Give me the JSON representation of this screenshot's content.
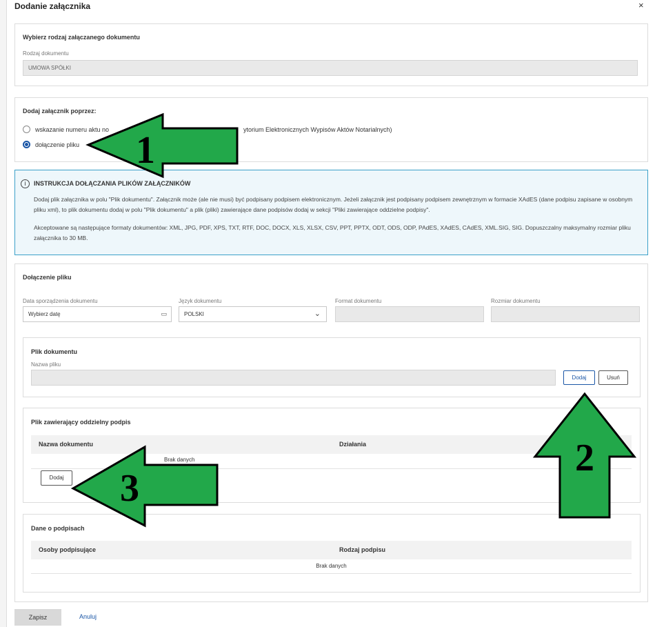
{
  "modal": {
    "title": "Dodanie załącznika"
  },
  "doc_type": {
    "title": "Wybierz rodzaj załączanego dokumentu",
    "label": "Rodzaj dokumentu",
    "value": "UMOWA SPÓŁKI"
  },
  "attach_via": {
    "title": "Dodaj załącznik poprzez:",
    "option1_start": "wskazanie numeru aktu no",
    "option1_end": "ytorium Elektronicznych Wypisów Aktów Notarialnych)",
    "option2": "dołączenie pliku"
  },
  "instructions": {
    "title": "INSTRUKCJA DOŁĄCZANIA PLIKÓW ZAŁĄCZNIKÓW",
    "p1": "Dodaj plik załącznika w polu \"Plik dokumentu\". Załącznik może (ale nie musi) być podpisany podpisem elektronicznym. Jeżeli załącznik jest podpisany podpisem zewnętrznym w formacie XAdES (dane podpisu zapisane w osobnym pliku xml), to plik dokumentu dodaj w polu \"Plik dokumentu\" a plik (pliki) zawierające dane podpisów dodaj w sekcji \"Pliki zawierające oddzielne podpisy\".",
    "p2": "Akceptowane są następujące formaty dokumentów: XML, JPG, PDF, XPS, TXT, RTF, DOC, DOCX, XLS, XLSX, CSV, PPT, PPTX, ODT, ODS, ODP, PAdES, XAdES, CAdES, XML.SIG, SIG. Dopuszczalny maksymalny rozmiar pliku załącznika to 30 MB."
  },
  "attach_file": {
    "title": "Dołączenie pliku",
    "date_label": "Data sporządzenia dokumentu",
    "date_placeholder": "Wybierz datę",
    "lang_label": "Język dokumentu",
    "lang_value": "POLSKI",
    "format_label": "Format dokumentu",
    "size_label": "Rozmiar dokumentu"
  },
  "doc_file": {
    "title": "Plik dokumentu",
    "name_label": "Nazwa pliku",
    "add_label": "Dodaj",
    "remove_label": "Usuń"
  },
  "signature_file": {
    "title": "Plik zawierający oddzielny podpis",
    "col_name": "Nazwa dokumentu",
    "col_actions": "Działania",
    "empty": "Brak danych",
    "add_label": "Dodaj"
  },
  "signatures": {
    "title": "Dane o podpisach",
    "col_persons": "Osoby podpisujące",
    "col_type": "Rodzaj podpisu",
    "empty": "Brak danych"
  },
  "footer": {
    "save_label": "Zapisz",
    "cancel_label": "Anuluj"
  },
  "annotations": {
    "arrow1": "1",
    "arrow2": "2",
    "arrow3": "3"
  },
  "colors": {
    "arrow_fill": "#22a84a",
    "accent": "#1a56a6",
    "info_border": "#3aa0c8"
  }
}
